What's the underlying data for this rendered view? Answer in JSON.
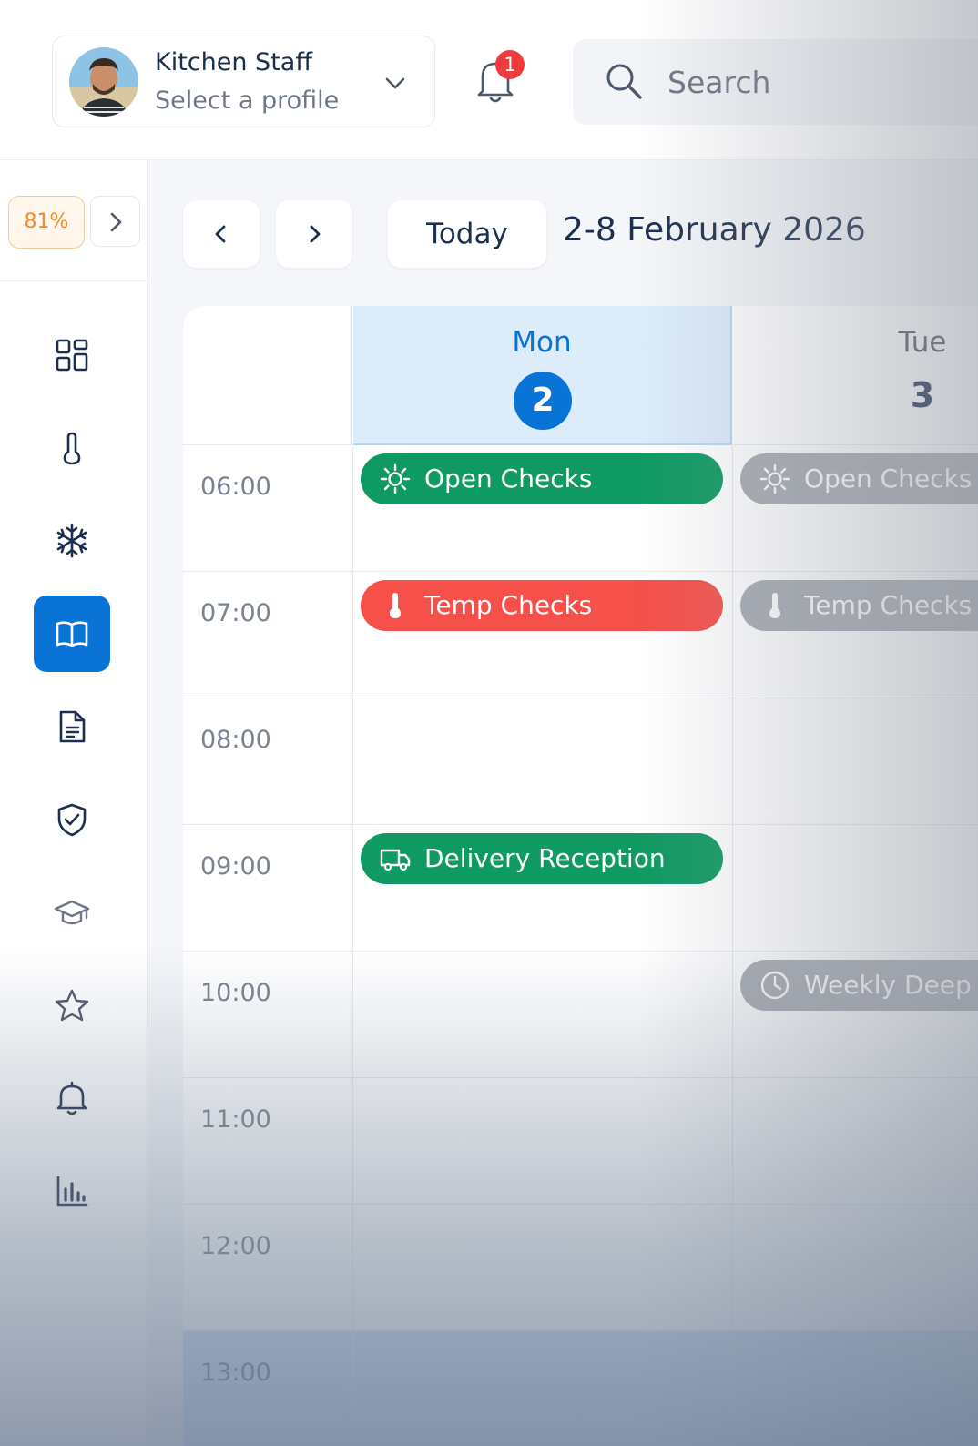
{
  "profile": {
    "name": "Kitchen Staff",
    "subtitle": "Select a profile"
  },
  "notifications": {
    "count": "1"
  },
  "search": {
    "placeholder": "Search"
  },
  "sidebar": {
    "progress": "81%",
    "items": [
      {
        "icon": "dashboard-icon"
      },
      {
        "icon": "thermometer-icon"
      },
      {
        "icon": "snowflake-icon"
      },
      {
        "icon": "book-icon",
        "active": true
      },
      {
        "icon": "document-icon"
      },
      {
        "icon": "shield-check-icon"
      },
      {
        "icon": "graduation-cap-icon"
      },
      {
        "icon": "star-icon"
      },
      {
        "icon": "bell-icon"
      },
      {
        "icon": "bar-chart-icon"
      }
    ]
  },
  "toolbar": {
    "today_label": "Today",
    "date_range": "2-8 February 2026"
  },
  "calendar": {
    "days": [
      {
        "name": "Mon",
        "number": "2",
        "selected": true
      },
      {
        "name": "Tue",
        "number": "3",
        "selected": false
      }
    ],
    "times": [
      "06:00",
      "07:00",
      "08:00",
      "09:00",
      "10:00",
      "11:00",
      "12:00",
      "13:00"
    ],
    "events": {
      "mon_open": "Open Checks",
      "mon_temp": "Temp Checks",
      "mon_delivery": "Delivery Reception",
      "tue_open": "Open Checks",
      "tue_temp": "Temp Checks",
      "tue_weekly": "Weekly Deep"
    }
  },
  "colors": {
    "accent": "#0a74d6",
    "event_green": "#0f9a63",
    "event_red": "#f5504a",
    "event_grey": "#a7abb2",
    "progress_orange": "#f08c2b"
  }
}
